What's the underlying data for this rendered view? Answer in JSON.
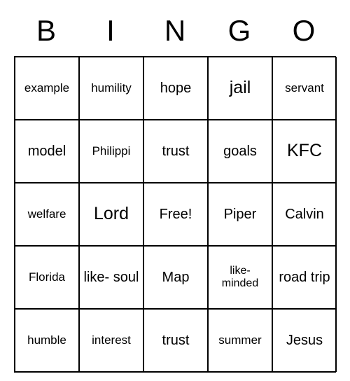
{
  "header": [
    "B",
    "I",
    "N",
    "G",
    "O"
  ],
  "grid": [
    [
      {
        "text": "example",
        "size": "small"
      },
      {
        "text": "humility",
        "size": "small"
      },
      {
        "text": "hope",
        "size": ""
      },
      {
        "text": "jail",
        "size": "big"
      },
      {
        "text": "servant",
        "size": "small"
      }
    ],
    [
      {
        "text": "model",
        "size": ""
      },
      {
        "text": "Philippi",
        "size": "small"
      },
      {
        "text": "trust",
        "size": ""
      },
      {
        "text": "goals",
        "size": ""
      },
      {
        "text": "KFC",
        "size": "big"
      }
    ],
    [
      {
        "text": "welfare",
        "size": "small"
      },
      {
        "text": "Lord",
        "size": "big"
      },
      {
        "text": "Free!",
        "size": ""
      },
      {
        "text": "Piper",
        "size": ""
      },
      {
        "text": "Calvin",
        "size": ""
      }
    ],
    [
      {
        "text": "Florida",
        "size": "small"
      },
      {
        "text": "like-\nsoul",
        "size": ""
      },
      {
        "text": "Map",
        "size": ""
      },
      {
        "text": "like-\nminded",
        "size": "xsmall"
      },
      {
        "text": "road trip",
        "size": ""
      }
    ],
    [
      {
        "text": "humble",
        "size": "small"
      },
      {
        "text": "interest",
        "size": "small"
      },
      {
        "text": "trust",
        "size": ""
      },
      {
        "text": "summer",
        "size": "small"
      },
      {
        "text": "Jesus",
        "size": ""
      }
    ]
  ]
}
